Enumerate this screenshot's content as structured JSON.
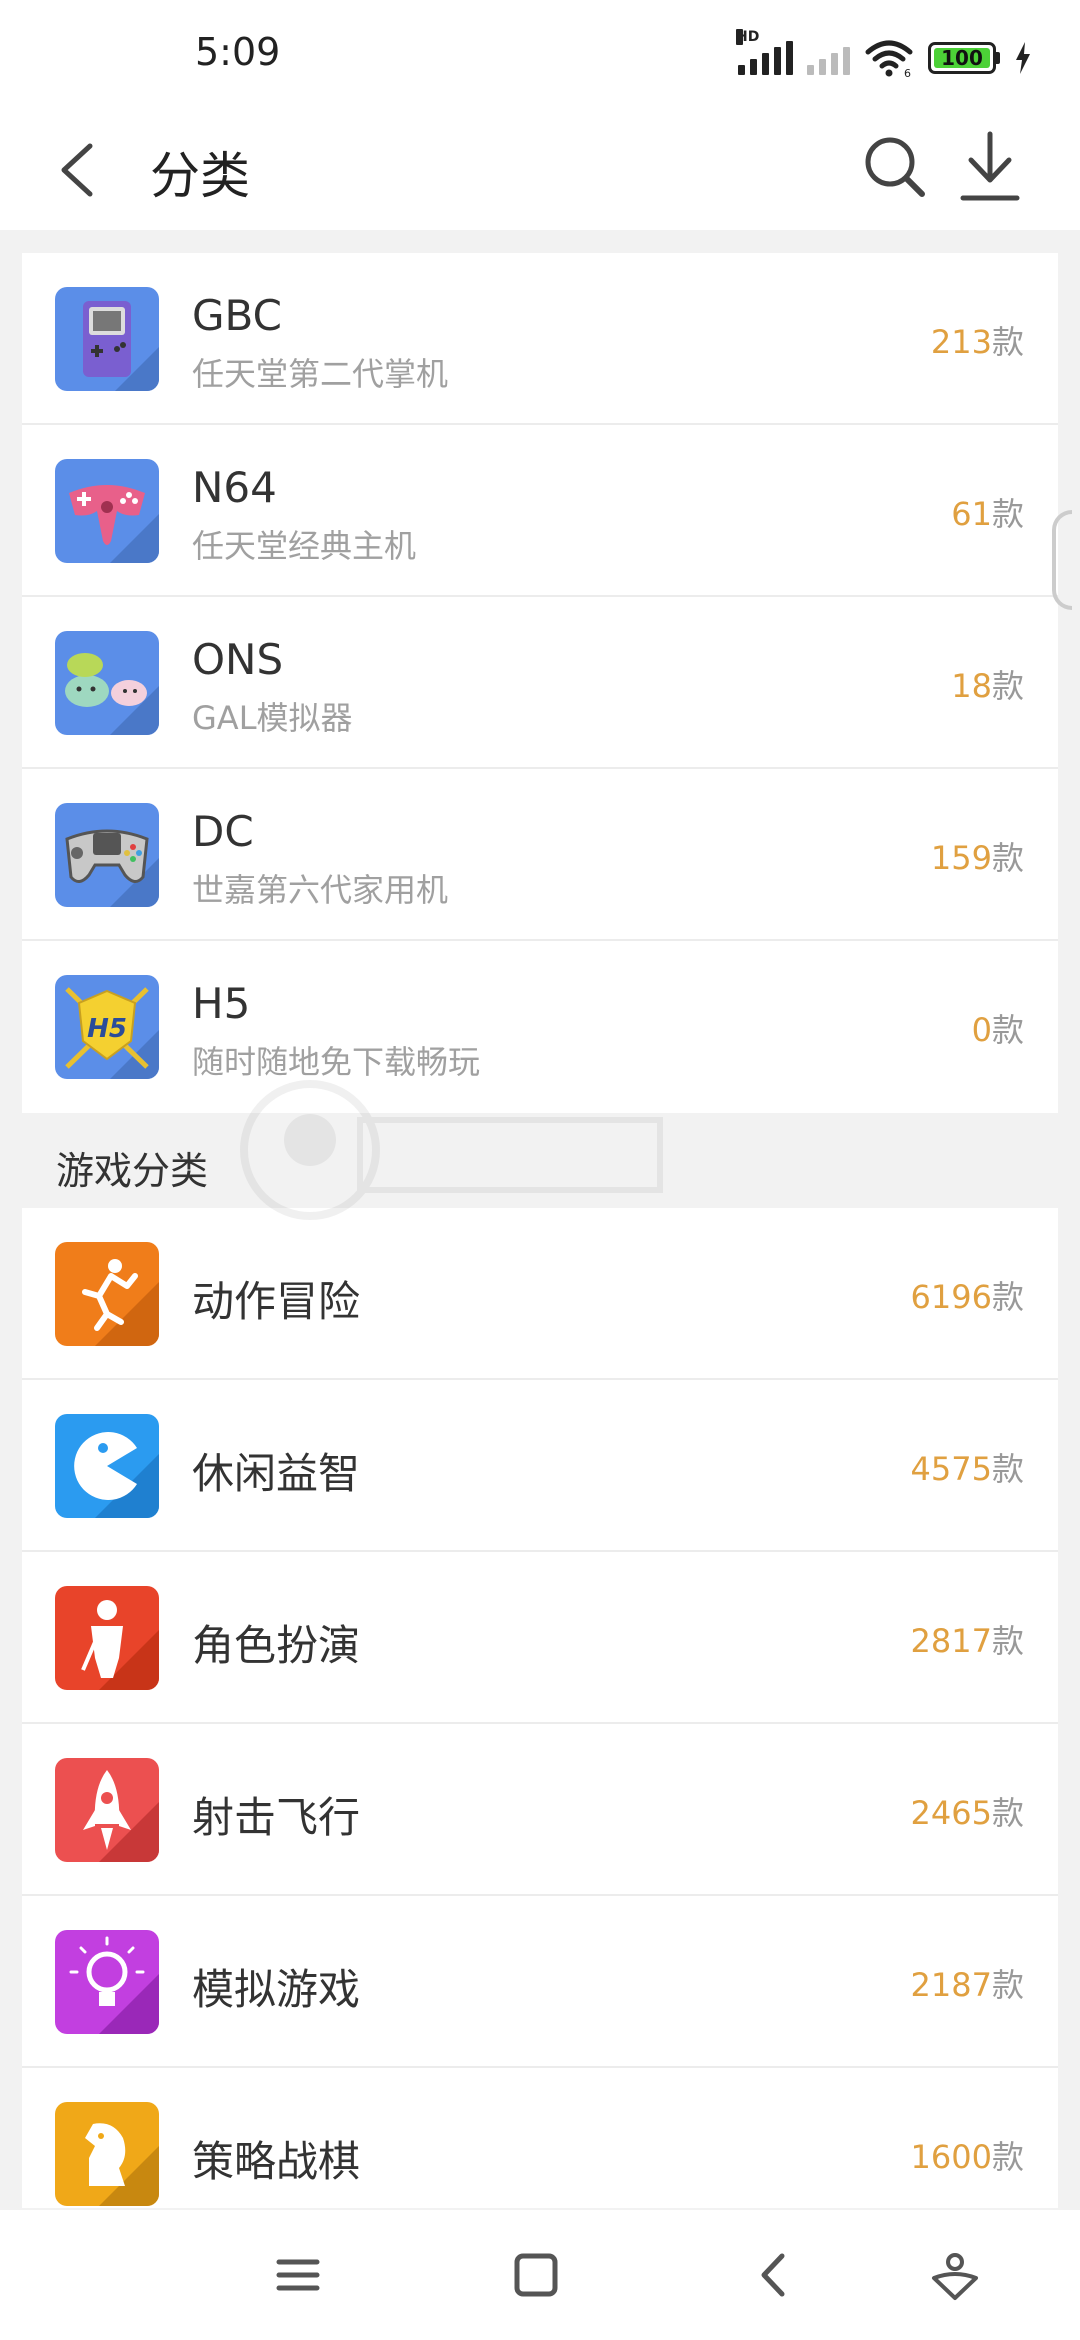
{
  "status": {
    "time": "5:09",
    "signal_label": "HD",
    "battery": "100",
    "wifi_label": "6"
  },
  "header": {
    "title": "分类",
    "back_icon": "chevron-left-icon",
    "search_icon": "search-icon",
    "download_icon": "download-icon"
  },
  "platforms": [
    {
      "title": "GBC",
      "subtitle": "任天堂第二代掌机",
      "count": "213",
      "unit": "款",
      "icon": "gameboy-icon",
      "color": "#5b8ee8"
    },
    {
      "title": "N64",
      "subtitle": "任天堂经典主机",
      "count": "61",
      "unit": "款",
      "icon": "n64-controller-icon",
      "color": "#5b8ee8"
    },
    {
      "title": "ONS",
      "subtitle": "GAL模拟器",
      "count": "18",
      "unit": "款",
      "icon": "slime-icon",
      "color": "#5b8ee8"
    },
    {
      "title": "DC",
      "subtitle": "世嘉第六代家用机",
      "count": "159",
      "unit": "款",
      "icon": "dreamcast-controller-icon",
      "color": "#5b8ee8"
    },
    {
      "title": "H5",
      "subtitle": "随时随地免下载畅玩",
      "count": "0",
      "unit": "款",
      "icon": "h5-badge-icon",
      "color": "#5b8ee8"
    }
  ],
  "section_title": "游戏分类",
  "categories": [
    {
      "title": "动作冒险",
      "count": "6196",
      "unit": "款",
      "icon": "runner-icon",
      "color": "#f07d1a"
    },
    {
      "title": "休闲益智",
      "count": "4575",
      "unit": "款",
      "icon": "pacman-icon",
      "color": "#2b9bf0"
    },
    {
      "title": "角色扮演",
      "count": "2817",
      "unit": "款",
      "icon": "knight-icon",
      "color": "#e8442a"
    },
    {
      "title": "射击飞行",
      "count": "2465",
      "unit": "款",
      "icon": "rocket-icon",
      "color": "#ec5050"
    },
    {
      "title": "模拟游戏",
      "count": "2187",
      "unit": "款",
      "icon": "lightbulb-icon",
      "color": "#c23fe0"
    },
    {
      "title": "策略战棋",
      "count": "1600",
      "unit": "款",
      "icon": "chess-knight-icon",
      "color": "#f0a818"
    }
  ],
  "nav": {
    "menu_icon": "menu-icon",
    "home_icon": "home-square-icon",
    "back_icon": "back-triangle-icon",
    "assist_icon": "assistant-icon"
  }
}
